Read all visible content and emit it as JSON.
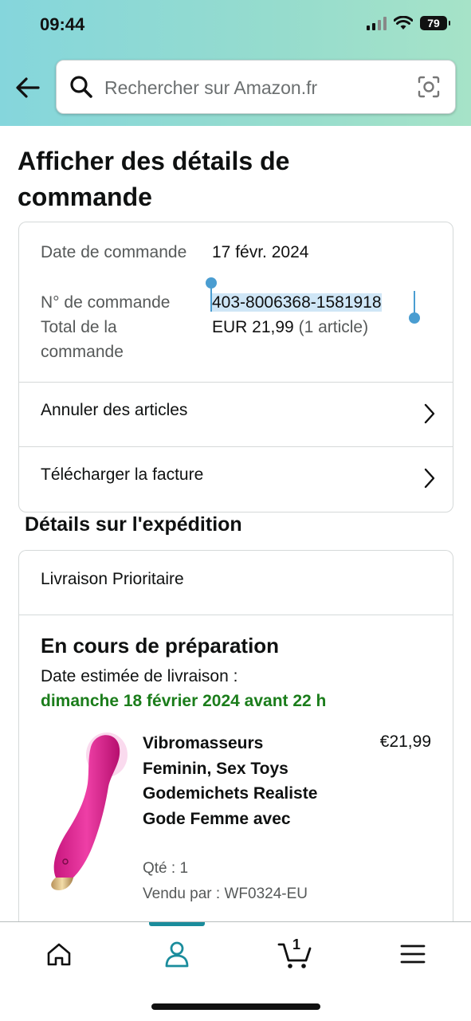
{
  "status_bar": {
    "time": "09:44",
    "battery": "79"
  },
  "search": {
    "placeholder": "Rechercher sur Amazon.fr"
  },
  "page": {
    "title": "Afficher des détails de commande"
  },
  "order_summary": {
    "date_label": "Date de commande",
    "date_value": "17 févr. 2024",
    "number_label": "N° de commande",
    "number_value": "403-8006368-1581918",
    "total_label": "Total de la commande",
    "total_value": "EUR 21,99",
    "total_items": "(1 article)",
    "links": [
      {
        "label": "Annuler des articles"
      },
      {
        "label": "Télécharger la facture"
      }
    ]
  },
  "shipping": {
    "section_title": "Détails sur l'expédition",
    "method": "Livraison Prioritaire",
    "status": "En cours de préparation",
    "estimated_label": "Date estimée de livraison :",
    "estimated_date": "dimanche 18 février 2024 avant 22 h",
    "item": {
      "name": "Vibromasseurs Feminin, Sex Toys Godemichets Realiste Gode Femme avec",
      "price": "€21,99",
      "qty": "Qté : 1",
      "seller": "Vendu par : WF0324-EU"
    }
  },
  "navbar": {
    "cart_count": "1",
    "items": [
      "home-icon",
      "account-icon",
      "cart-icon",
      "menu-icon"
    ]
  },
  "colors": {
    "accent": "#1a8c9c",
    "delivery_green": "#1b7d1b",
    "header_gradient_start": "#85d6dc",
    "header_gradient_end": "#a6e3c8"
  }
}
